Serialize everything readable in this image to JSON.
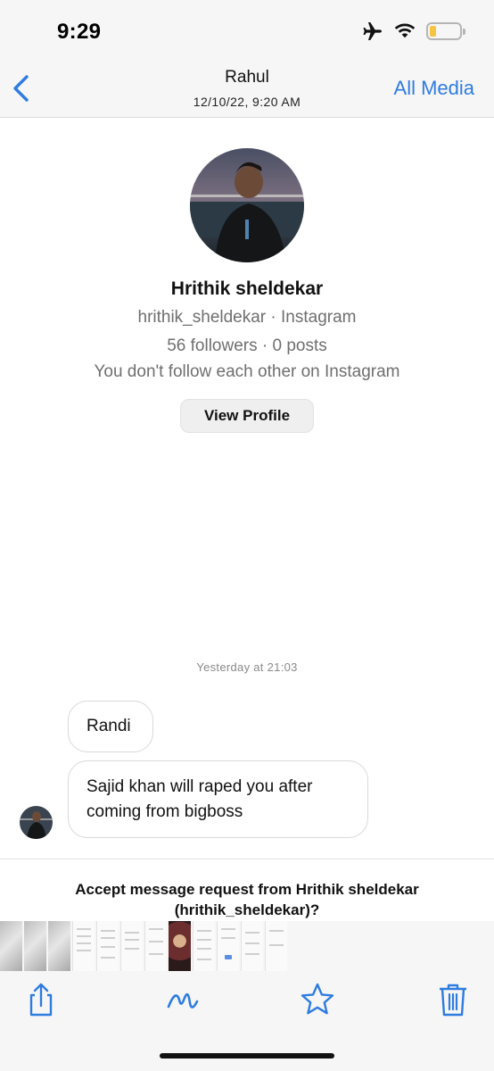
{
  "status_bar": {
    "time": "9:29",
    "icons": [
      "airplane-icon",
      "wifi-icon",
      "battery-icon"
    ],
    "battery_color": "#f5c542"
  },
  "nav": {
    "back_icon": "chevron-left-icon",
    "title": "Rahul",
    "subtitle": "12/10/22, 9:20 AM",
    "all_media_label": "All Media",
    "accent_color": "#2f7ce0"
  },
  "profile": {
    "name": "Hrithik sheldekar",
    "handle_line": "hrithik_sheldekar · Instagram",
    "stats_line": "56 followers · 0 posts",
    "follow_line": "You don't follow each other on Instagram",
    "view_profile_label": "View Profile"
  },
  "chat": {
    "timestamp": "Yesterday at 21:03",
    "messages": [
      {
        "text": "Randi"
      },
      {
        "text": "Sajid khan will raped you after coming from bigboss"
      }
    ]
  },
  "request": {
    "text": "Accept message request from Hrithik sheldekar (hrithik_sheldekar)?"
  },
  "toolbar": {
    "icons": [
      "share-icon",
      "markup-icon",
      "star-icon",
      "trash-icon"
    ]
  }
}
